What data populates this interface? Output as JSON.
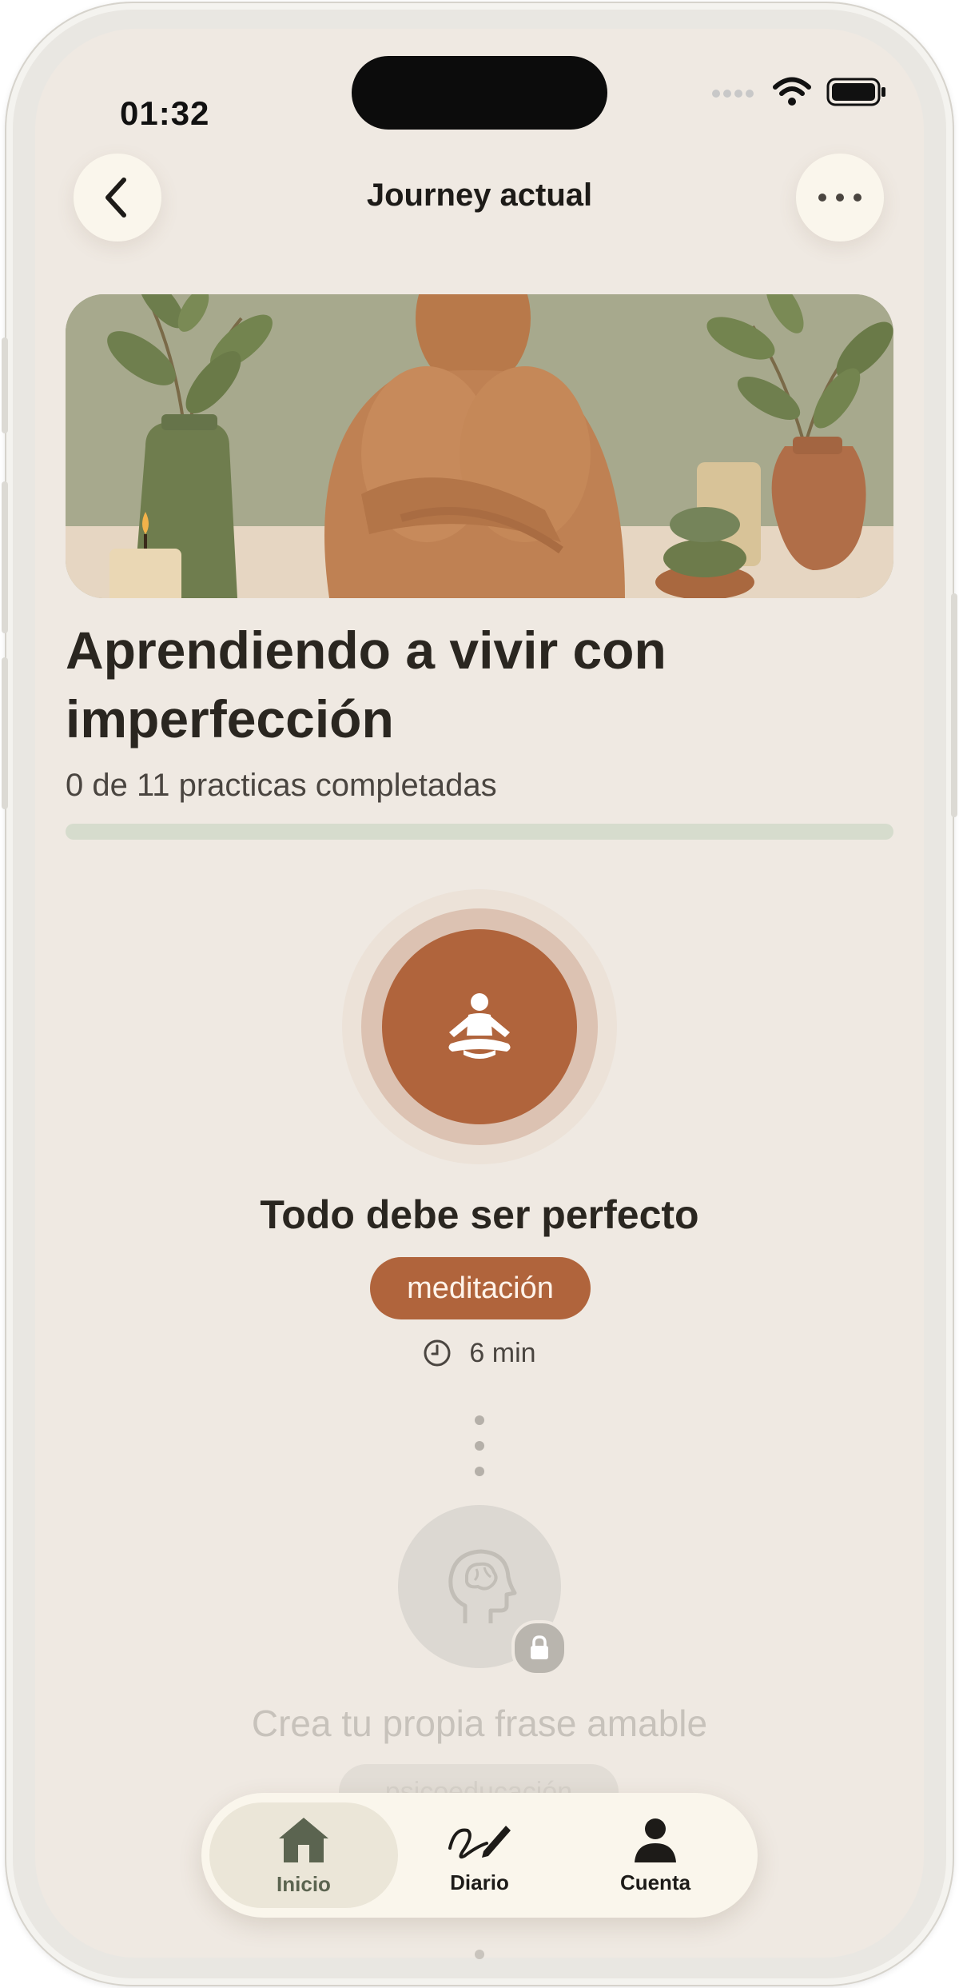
{
  "status_bar": {
    "time": "01:32"
  },
  "nav": {
    "title": "Journey actual",
    "back_icon": "chevron-left-icon",
    "more_icon": "more-horizontal-icon"
  },
  "journey": {
    "title": "Aprendiendo a vivir con imperfección",
    "progress_text": "0 de 11 practicas completadas",
    "completed": 0,
    "total": 11
  },
  "current_practice": {
    "title": "Todo debe ser perfecto",
    "tag": "meditación",
    "duration": "6 min",
    "icon": "meditation-icon",
    "accent": "#b0643c"
  },
  "next_practice": {
    "title": "Crea tu propia frase amable",
    "tag": "psicoeducación",
    "icon": "head-brain-icon",
    "locked": true
  },
  "tabbar": {
    "items": [
      {
        "label": "Inicio",
        "icon": "home-icon",
        "active": true
      },
      {
        "label": "Diario",
        "icon": "pen-icon",
        "active": false
      },
      {
        "label": "Cuenta",
        "icon": "person-icon",
        "active": false
      }
    ]
  },
  "colors": {
    "background": "#efe9e2",
    "progress_track": "#d6dccd",
    "tabbar": "#faf6ec"
  }
}
